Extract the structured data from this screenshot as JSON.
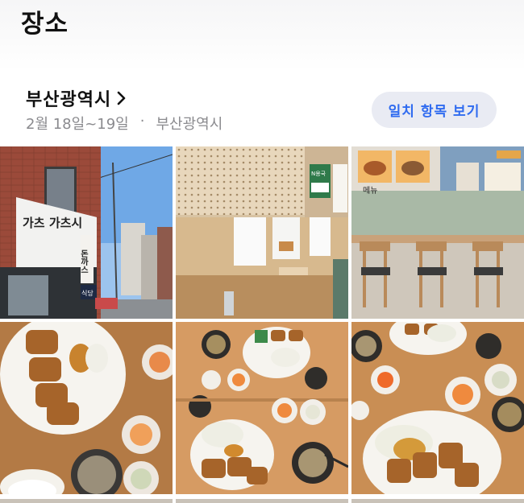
{
  "header": {
    "title": "장소"
  },
  "place": {
    "name": "부산광역시",
    "date_range": "2월 18일~19일",
    "separator": "·",
    "location": "부산광역시",
    "match_button_label": "일치 항목 보기"
  },
  "colors": {
    "accent": "#2f6bf0",
    "button_bg": "#e9ebf3",
    "secondary_text": "#8a8a8e"
  },
  "photos": [
    {
      "sign_text": "가츠 가츠시",
      "vertical_sign": "돈까스",
      "sign2": "식당"
    },
    {
      "notice": "N용국"
    },
    {
      "menu": "메뉴"
    },
    {},
    {},
    {}
  ]
}
